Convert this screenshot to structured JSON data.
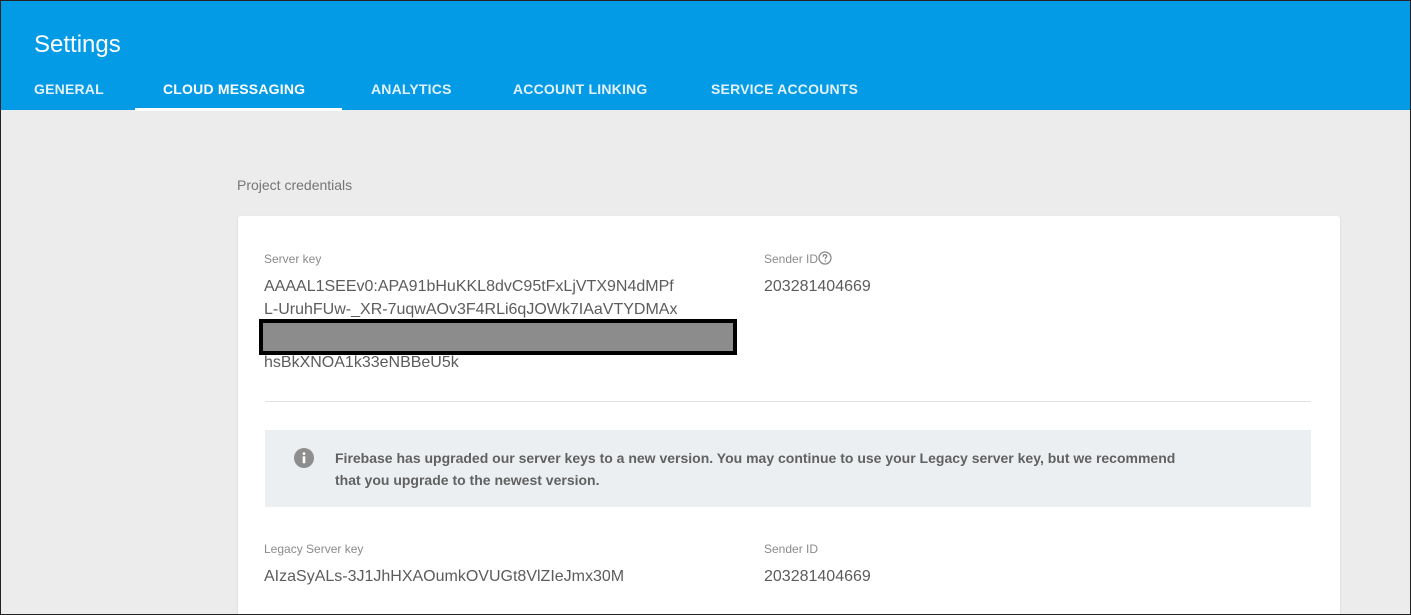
{
  "header": {
    "title": "Settings",
    "tabs": [
      {
        "label": "GENERAL",
        "active": false
      },
      {
        "label": "CLOUD MESSAGING",
        "active": true
      },
      {
        "label": "ANALYTICS",
        "active": false
      },
      {
        "label": "ACCOUNT LINKING",
        "active": false
      },
      {
        "label": "SERVICE ACCOUNTS",
        "active": false
      }
    ]
  },
  "main": {
    "section_title": "Project credentials",
    "server_key": {
      "label": "Server key",
      "line1": "AAAAL1SEEv0:APA91bHuKKL8dvC95tFxLjVTX9N4dMPf",
      "line2": "L-UruhFUw-_XR-7uqwAOv3F4RLi6qJOWk7IAaVTYDMAx",
      "line4": "hsBkXNOA1k33eNBBeU5k"
    },
    "sender_id": {
      "label": "Sender ID",
      "value": "203281404669",
      "icon": "help-circle-icon"
    },
    "notice": {
      "icon": "info-icon",
      "line1": "Firebase has upgraded our server keys to a new version. You may continue to use your Legacy server key, but we recommend",
      "line2": "that you upgrade to the newest version."
    },
    "legacy_server_key": {
      "label": "Legacy Server key",
      "value": "AIzaSyALs-3J1JhHXAOumkOVUGt8VlZIeJmx30M"
    },
    "legacy_sender_id": {
      "label": "Sender ID",
      "value": "203281404669"
    }
  },
  "colors": {
    "header_bg": "#039be5",
    "page_bg": "#ececec",
    "notice_bg": "#eceff1"
  }
}
